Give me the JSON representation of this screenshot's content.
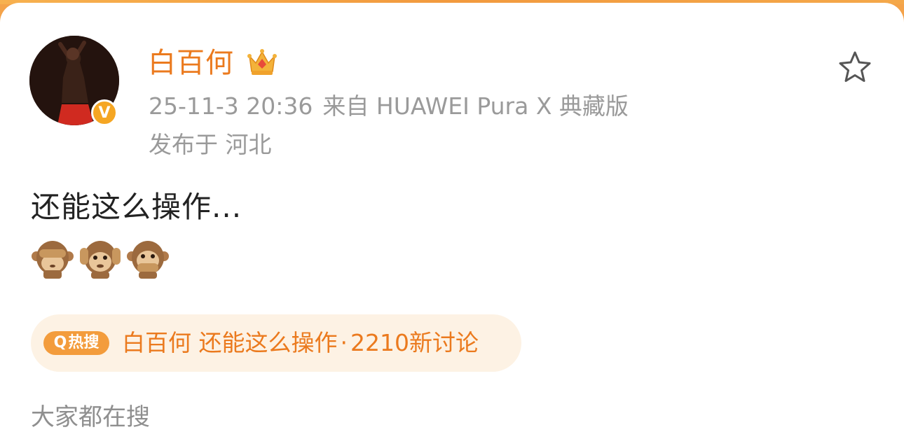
{
  "post": {
    "username": "白百何",
    "crown_icon": "crown-icon",
    "verified_badge": "V",
    "timestamp": "25-11-3 20:36",
    "source": "来自 HUAWEI Pura X 典藏版",
    "location": "发布于 河北",
    "text": "还能这么操作...",
    "emojis": [
      "see-no-evil-monkey",
      "hear-no-evil-monkey",
      "speak-no-evil-monkey"
    ]
  },
  "hot_search": {
    "tag_label": "热搜",
    "name": "白百何",
    "topic": "还能这么操作",
    "separator": "·",
    "count": "2210新讨论"
  },
  "footer": {
    "everyone_searching": "大家都在搜"
  },
  "colors": {
    "accent": "#eb7a1e",
    "tag": "#f39c3c",
    "pill_bg": "#fdf2e4",
    "meta": "#9a9a9a"
  }
}
